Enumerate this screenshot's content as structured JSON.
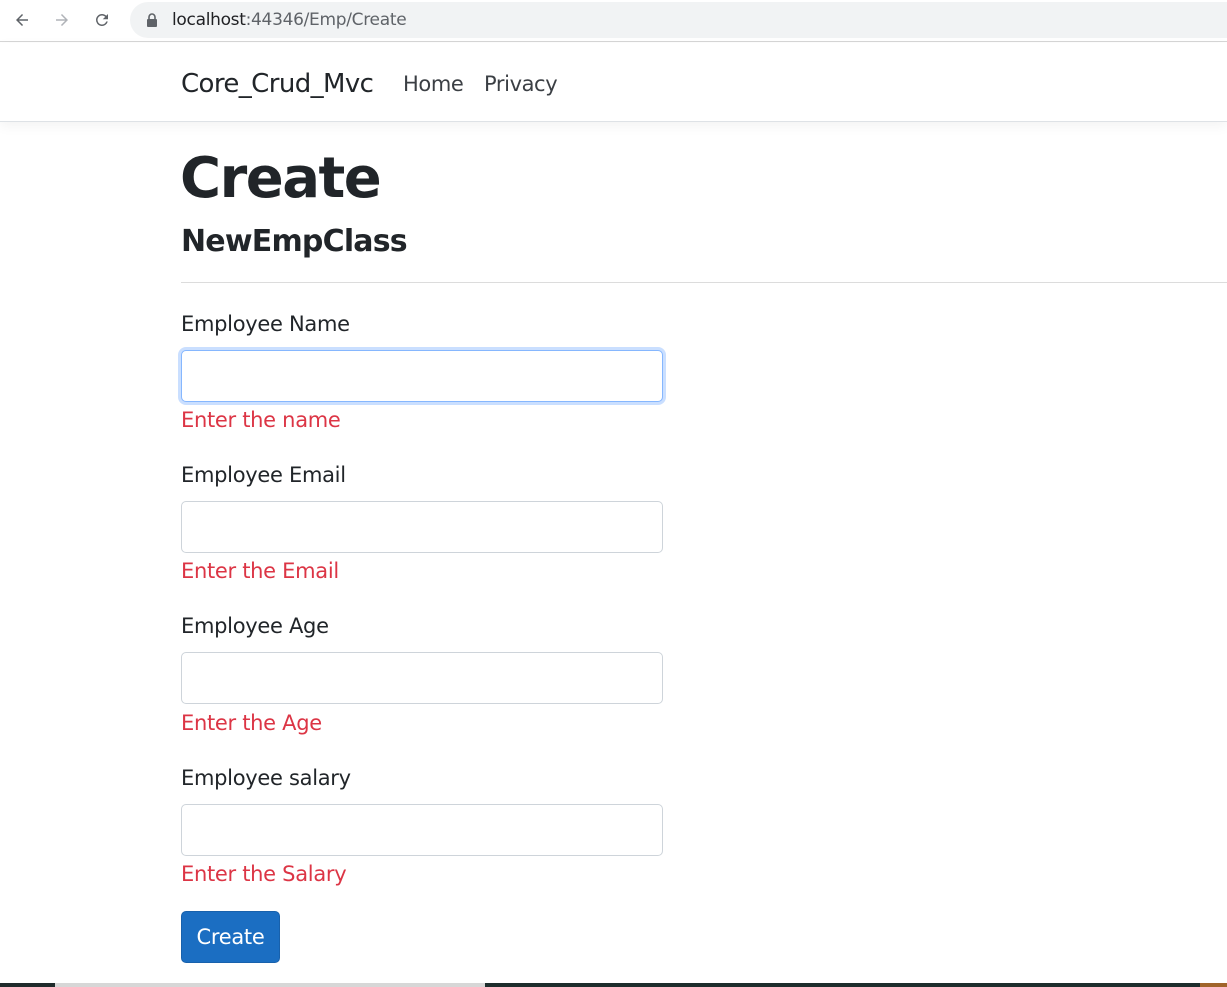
{
  "browser": {
    "url_host": "localhost",
    "url_rest": ":44346/Emp/Create"
  },
  "navbar": {
    "brand": "Core_Crud_Mvc",
    "links": [
      "Home",
      "Privacy"
    ]
  },
  "page": {
    "title": "Create",
    "subtitle": "NewEmpClass"
  },
  "form": {
    "fields": [
      {
        "label": "Employee Name",
        "value": "",
        "error": "Enter the name"
      },
      {
        "label": "Employee Email",
        "value": "",
        "error": "Enter the Email"
      },
      {
        "label": "Employee Age",
        "value": "",
        "error": "Enter the Age"
      },
      {
        "label": "Employee salary",
        "value": "",
        "error": "Enter the Salary"
      }
    ],
    "submit_label": "Create"
  },
  "colors": {
    "error": "#dc3545",
    "primary": "#1b6ec2",
    "focus": "#86b7fe"
  },
  "icons": [
    "back-arrow-icon",
    "forward-arrow-icon",
    "reload-icon",
    "lock-icon"
  ]
}
